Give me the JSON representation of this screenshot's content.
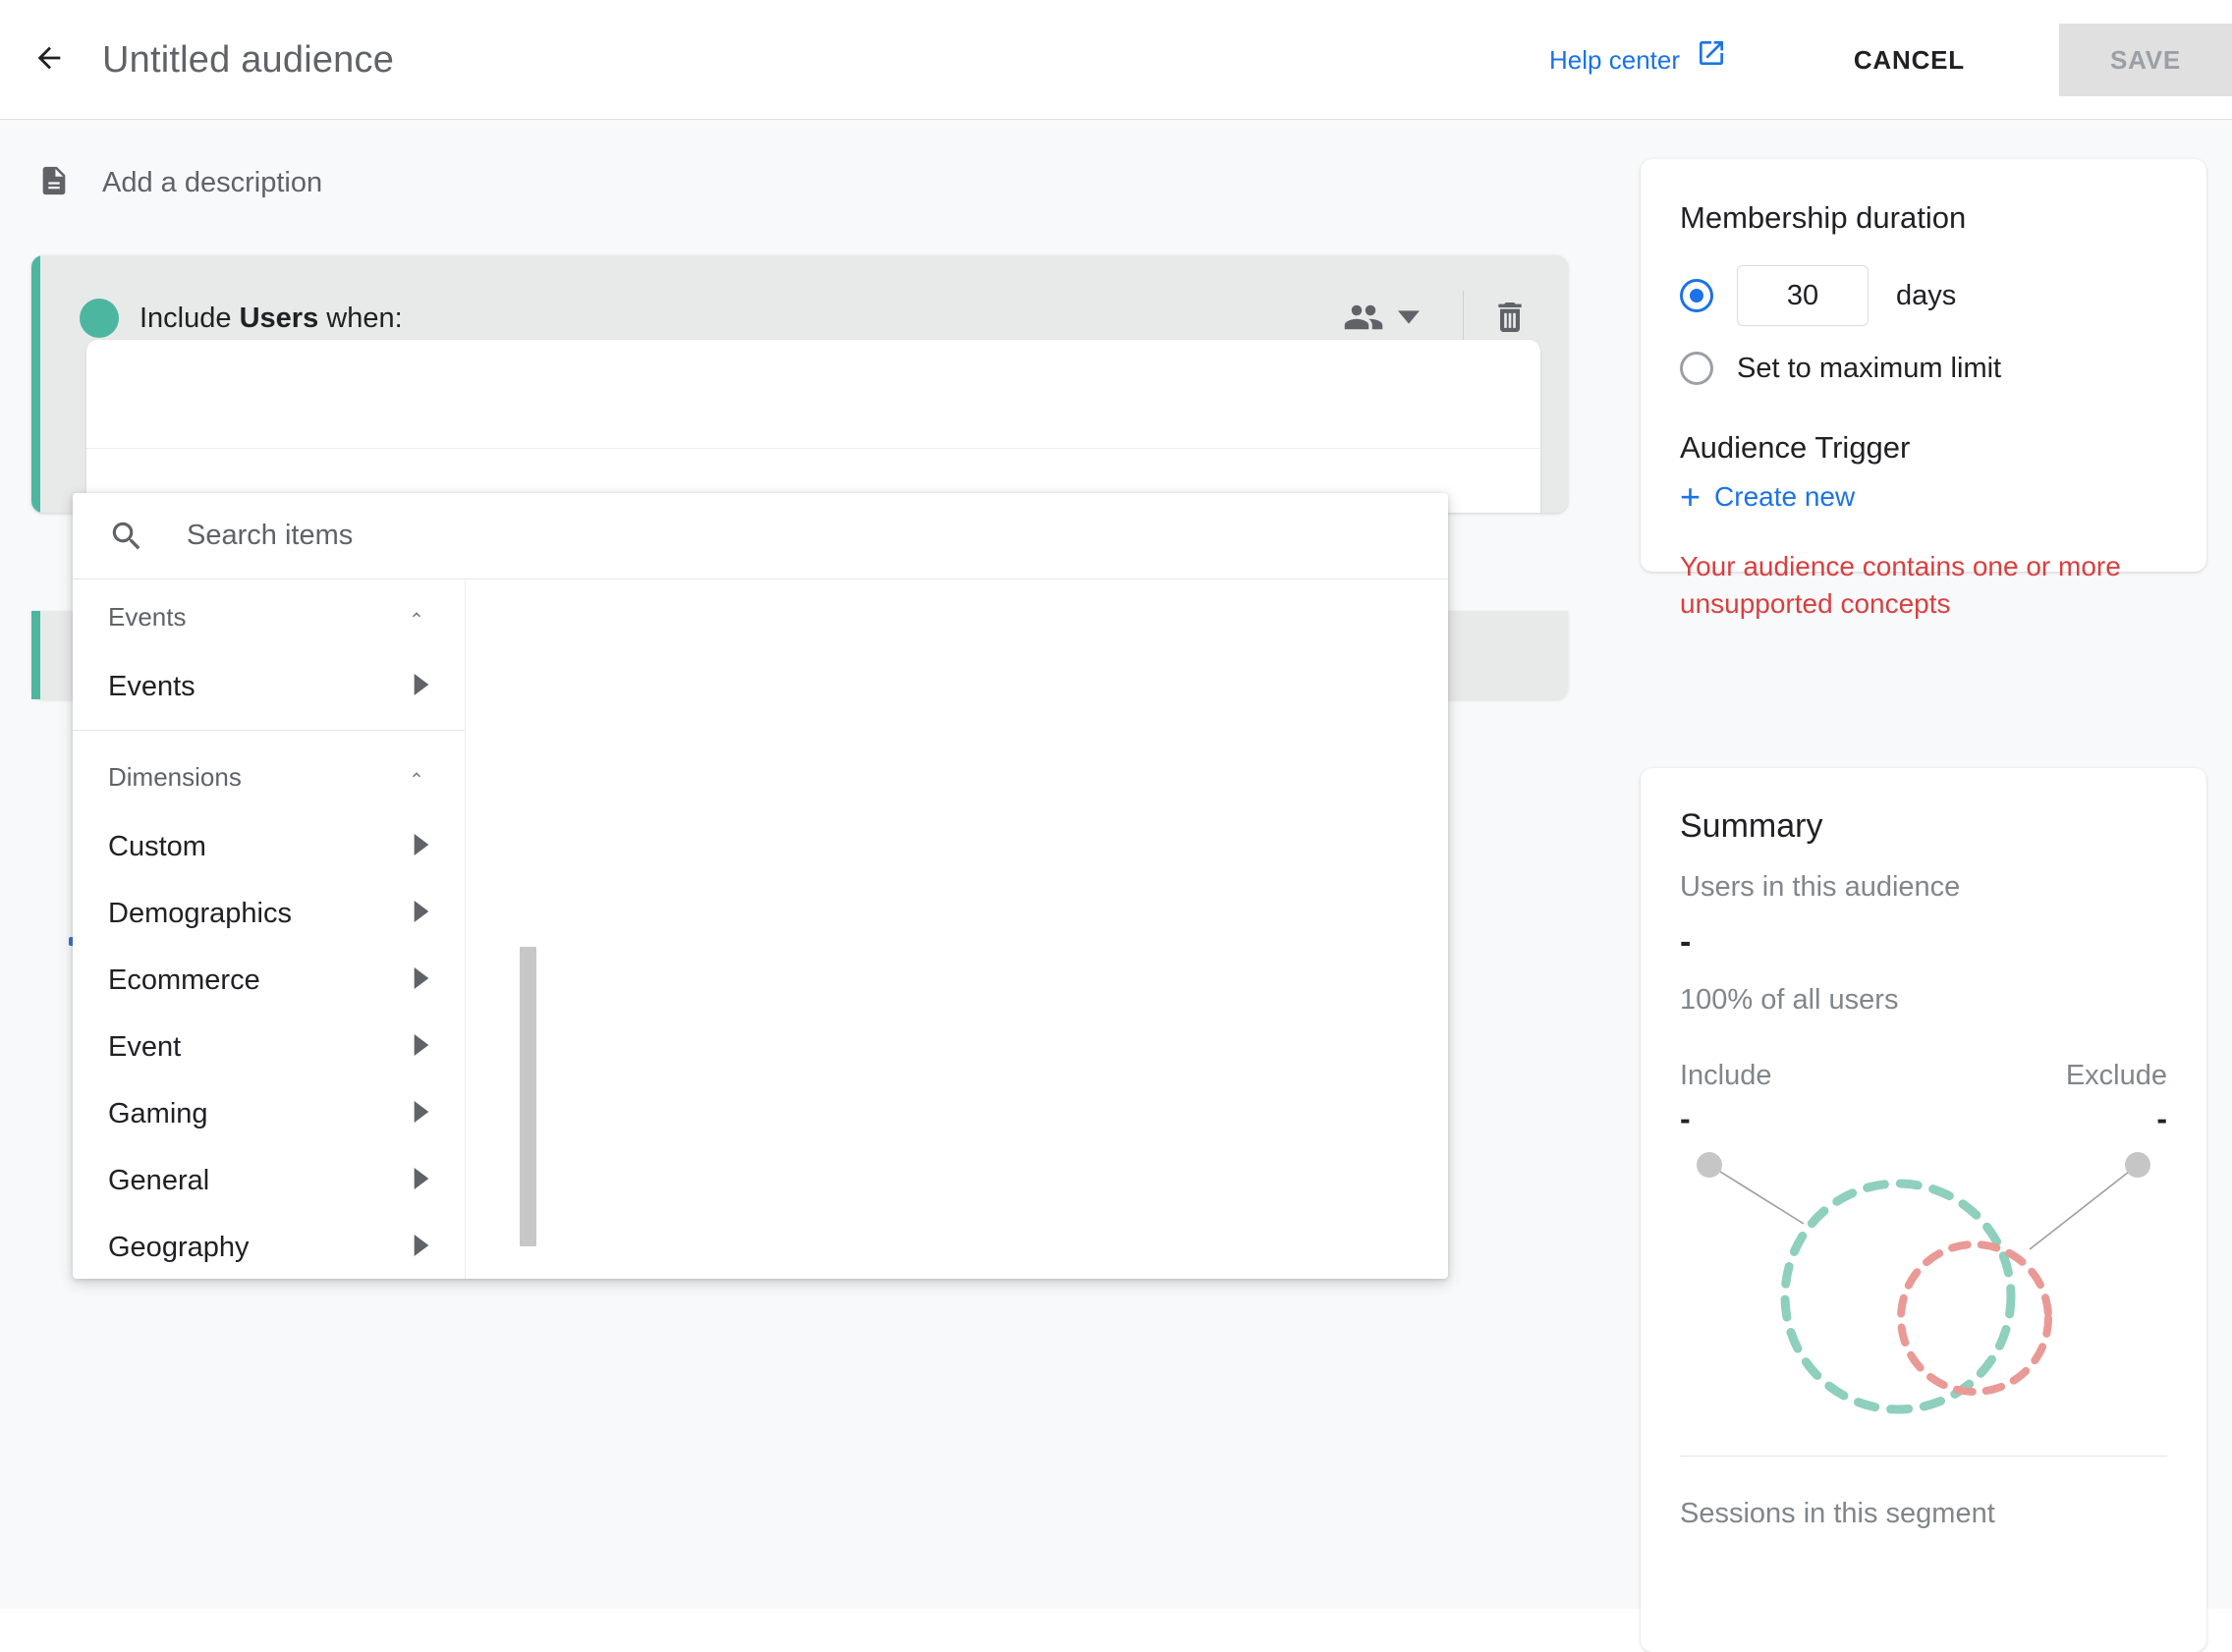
{
  "header": {
    "back_icon": "arrow-left-icon",
    "title": "Untitled audience",
    "help_label": "Help center",
    "help_icon": "open-in-new-icon",
    "cancel_label": "CANCEL",
    "save_label": "SAVE"
  },
  "description": {
    "icon": "description-icon",
    "placeholder": "Add a description"
  },
  "condition": {
    "prefix": "Include ",
    "scope": "Users",
    "suffix": " when:",
    "scope_icon": "people-icon",
    "caret_icon": "chevron-down-icon",
    "delete_icon": "trash-icon",
    "accent_color": "#4db6a0"
  },
  "dropdown": {
    "search_placeholder": "Search items",
    "search_value": "",
    "search_icon": "search-icon",
    "groups": [
      {
        "label": "Events",
        "collapse_icon": "chevron-up-icon",
        "items": [
          {
            "label": "Events",
            "arrow_icon": "chevron-right-icon"
          }
        ]
      },
      {
        "label": "Dimensions",
        "collapse_icon": "chevron-up-icon",
        "items": [
          {
            "label": "Custom",
            "arrow_icon": "chevron-right-icon"
          },
          {
            "label": "Demographics",
            "arrow_icon": "chevron-right-icon"
          },
          {
            "label": "Ecommerce",
            "arrow_icon": "chevron-right-icon"
          },
          {
            "label": "Event",
            "arrow_icon": "chevron-right-icon"
          },
          {
            "label": "Gaming",
            "arrow_icon": "chevron-right-icon"
          },
          {
            "label": "General",
            "arrow_icon": "chevron-right-icon"
          },
          {
            "label": "Geography",
            "arrow_icon": "chevron-right-icon"
          }
        ]
      }
    ]
  },
  "membership": {
    "title": "Membership duration",
    "days_value": "30",
    "days_label": "days",
    "max_limit_label": "Set to maximum limit",
    "selected": "days",
    "trigger_title": "Audience Trigger",
    "create_new_label": "Create new",
    "create_new_icon": "plus-icon",
    "error_text": "Your audience contains one or more unsupported concepts",
    "error_color": "#d93f3f",
    "accent_color": "#1a73e8"
  },
  "summary": {
    "title": "Summary",
    "users_label": "Users in this audience",
    "users_value": "-",
    "percent_label": "100% of all users",
    "include_label": "Include",
    "exclude_label": "Exclude",
    "include_value": "-",
    "exclude_value": "-",
    "include_color": "#8ecfbe",
    "exclude_color": "#e99a96",
    "footer_label": "Sessions in this segment"
  }
}
